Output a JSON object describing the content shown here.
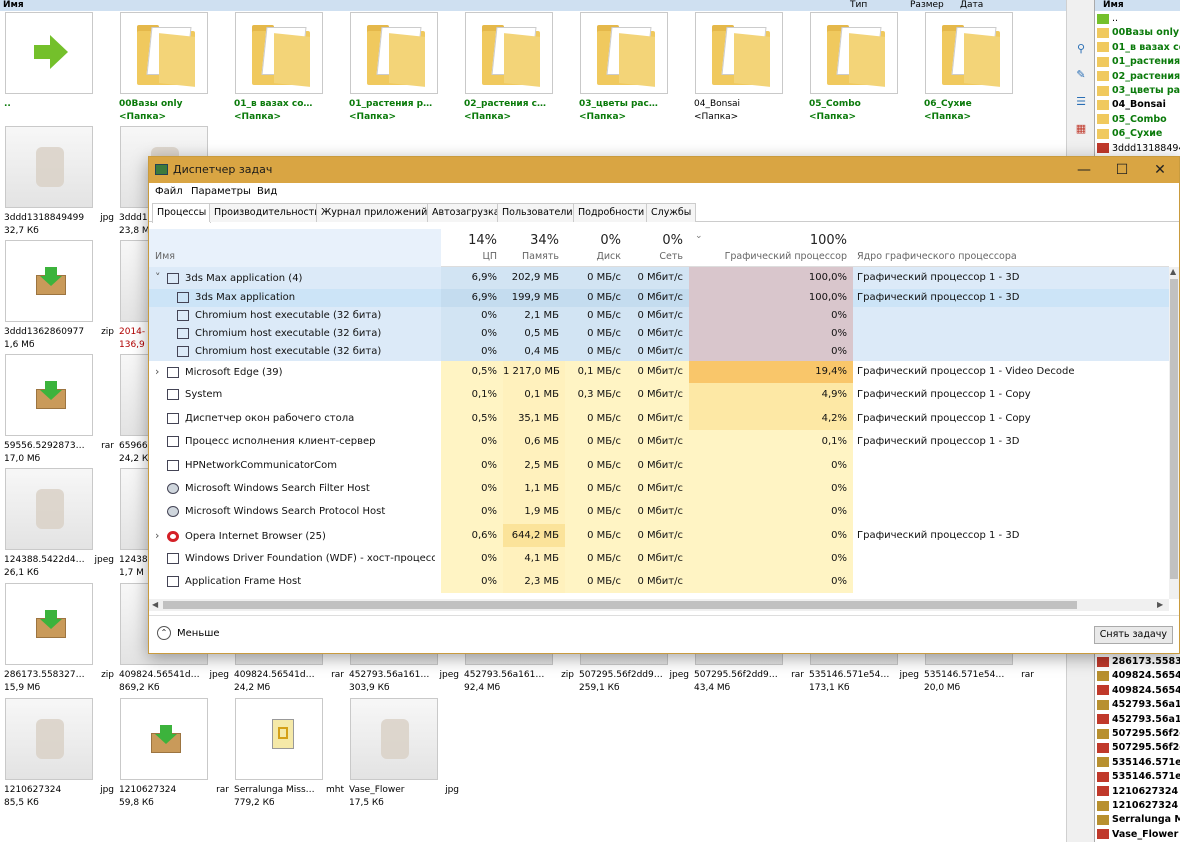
{
  "background": {
    "header": {
      "name": "Имя",
      "type": "Тип",
      "size": "Размер",
      "date": "Дата"
    },
    "tiles": [
      {
        "kind": "up",
        "name": "..",
        "sub": "",
        "ext": "",
        "green": true
      },
      {
        "kind": "folder",
        "name": "00Вазы only",
        "sub": "<Папка>",
        "ext": "",
        "green": true
      },
      {
        "kind": "folder",
        "name": "01_в вазах сорванн...",
        "sub": "<Папка>",
        "ext": "",
        "green": true
      },
      {
        "kind": "folder",
        "name": "01_растения растущ...",
        "sub": "<Папка>",
        "ext": "",
        "green": true
      },
      {
        "kind": "folder",
        "name": "02_растения свисаю...",
        "sub": "<Папка>",
        "ext": "",
        "green": true
      },
      {
        "kind": "folder",
        "name": "03_цветы растущие",
        "sub": "<Папка>",
        "ext": "",
        "green": true
      },
      {
        "kind": "folder",
        "name": "04_Bonsai",
        "sub": "<Папка>",
        "ext": "",
        "green": false
      },
      {
        "kind": "folder",
        "name": "05_Combo",
        "sub": "<Папка>",
        "ext": "",
        "green": true
      },
      {
        "kind": "folder",
        "name": "06_Сухие",
        "sub": "<Папка>",
        "ext": "",
        "green": true
      },
      {
        "kind": "img",
        "name": "3ddd1318849499",
        "sub": "32,7 Кб",
        "ext": "jpg"
      },
      {
        "kind": "img",
        "name": "3ddd1",
        "sub": "23,8 М",
        "ext": ""
      },
      {
        "kind": "box",
        "name": "3ddd1362860977",
        "sub": "1,6 Мб",
        "ext": "zip"
      },
      {
        "kind": "img",
        "name": "2014-",
        "sub": "136,9",
        "ext": "",
        "red": true
      },
      {
        "kind": "box",
        "name": "59556.529287385...",
        "sub": "17,0 Мб",
        "ext": "rar"
      },
      {
        "kind": "img",
        "name": "65966",
        "sub": "24,2 К",
        "ext": ""
      },
      {
        "kind": "img",
        "name": "124388.5422d4bf...",
        "sub": "26,1 Кб",
        "ext": "jpeg"
      },
      {
        "kind": "img",
        "name": "12438",
        "sub": "1,7 М",
        "ext": ""
      },
      {
        "kind": "box",
        "name": "286173.55832793...",
        "sub": "15,9 Мб",
        "ext": "zip"
      },
      {
        "kind": "img",
        "name": "409824.56541d6b...",
        "sub": "869,2 Кб",
        "ext": "jpeg"
      },
      {
        "kind": "img",
        "name": "409824.56541d6b...",
        "sub": "24,2 Мб",
        "ext": "rar"
      },
      {
        "kind": "img",
        "name": "452793.56a1612...",
        "sub": "303,9 Кб",
        "ext": "jpeg"
      },
      {
        "kind": "img",
        "name": "452793.56a16127...",
        "sub": "92,4 Мб",
        "ext": "zip"
      },
      {
        "kind": "img",
        "name": "507295.56f2dd90...",
        "sub": "259,1 Кб",
        "ext": "jpeg"
      },
      {
        "kind": "img",
        "name": "507295.56f2dd90f...",
        "sub": "43,4 Мб",
        "ext": "rar"
      },
      {
        "kind": "img",
        "name": "535146.571e54e...",
        "sub": "173,1 Кб",
        "ext": "jpeg"
      },
      {
        "kind": "img",
        "name": "535146.571e54e1...",
        "sub": "20,0 Мб",
        "ext": "rar"
      },
      {
        "kind": "img",
        "name": "1210627324",
        "sub": "85,5 Кб",
        "ext": "jpg"
      },
      {
        "kind": "box",
        "name": "1210627324",
        "sub": "59,8 Кб",
        "ext": "rar"
      },
      {
        "kind": "mht",
        "name": "Serralunga Misse...",
        "sub": "779,2 Кб",
        "ext": "mht"
      },
      {
        "kind": "img",
        "name": "Vase_Flower",
        "sub": "17,5 Кб",
        "ext": "jpg"
      }
    ],
    "right_panel": {
      "header": "Имя",
      "items_top": [
        "..",
        "00Вазы only",
        "01_в вазах со",
        "01_растения р",
        "02_растения с",
        "03_цветы раст",
        "04_Bonsai",
        "05_Combo",
        "06_Сухие",
        "3ddd13188494"
      ],
      "items_bottom": [
        "286173.558327",
        "409824.56541d",
        "409824.56541d",
        "452793.56a161",
        "452793.56a161",
        "507295.56f2dd",
        "507295.56f2dd",
        "535146.571e54",
        "535146.571e54",
        "1210627324",
        "1210627324",
        "Serralunga Mis",
        "Vase_Flower"
      ]
    }
  },
  "taskmgr": {
    "title": "Диспетчер задач",
    "menu": [
      "Файл",
      "Параметры",
      "Вид"
    ],
    "tabs": [
      "Процессы",
      "Производительность",
      "Журнал приложений",
      "Автозагрузка",
      "Пользователи",
      "Подробности",
      "Службы"
    ],
    "columns": {
      "name": "Имя",
      "cpu_pct": "14%",
      "cpu": "ЦП",
      "mem_pct": "34%",
      "mem": "Память",
      "disk_pct": "0%",
      "disk": "Диск",
      "net_pct": "0%",
      "net": "Сеть",
      "gpu_pct": "100%",
      "gpu": "Графический процессор",
      "engine": "Ядро графического процессора"
    },
    "rows": [
      {
        "name": "3ds Max application (4)",
        "cpu": "6,9%",
        "mem": "202,9 МБ",
        "disk": "0 МБ/с",
        "net": "0 Мбит/с",
        "gpu": "100,0%",
        "engine": "Графический процессор 1 - 3D",
        "group": true,
        "expanded": true
      },
      {
        "name": "3ds Max application",
        "cpu": "6,9%",
        "mem": "199,9 МБ",
        "disk": "0 МБ/с",
        "net": "0 Мбит/с",
        "gpu": "100,0%",
        "engine": "Графический процессор 1 - 3D",
        "child": true
      },
      {
        "name": "Chromium host executable (32 бита)",
        "cpu": "0%",
        "mem": "2,1 МБ",
        "disk": "0 МБ/с",
        "net": "0 Мбит/с",
        "gpu": "0%",
        "engine": "",
        "child": true
      },
      {
        "name": "Chromium host executable (32 бита)",
        "cpu": "0%",
        "mem": "0,5 МБ",
        "disk": "0 МБ/с",
        "net": "0 Мбит/с",
        "gpu": "0%",
        "engine": "",
        "child": true
      },
      {
        "name": "Chromium host executable (32 бита)",
        "cpu": "0%",
        "mem": "0,4 МБ",
        "disk": "0 МБ/с",
        "net": "0 Мбит/с",
        "gpu": "0%",
        "engine": "",
        "child": true
      },
      {
        "name": "Microsoft Edge (39)",
        "cpu": "0,5%",
        "mem": "1 217,0 МБ",
        "disk": "0,1 МБ/с",
        "net": "0 Мбит/с",
        "gpu": "19,4%",
        "engine": "Графический процессор 1 - Video Decode",
        "group": true
      },
      {
        "name": "System",
        "cpu": "0,1%",
        "mem": "0,1 МБ",
        "disk": "0,3 МБ/с",
        "net": "0 Мбит/с",
        "gpu": "4,9%",
        "engine": "Графический процессор 1 - Copy"
      },
      {
        "name": "Диспетчер окон рабочего стола",
        "cpu": "0,5%",
        "mem": "35,1 МБ",
        "disk": "0 МБ/с",
        "net": "0 Мбит/с",
        "gpu": "4,2%",
        "engine": "Графический процессор 1 - Copy"
      },
      {
        "name": "Процесс исполнения клиент-сервер",
        "cpu": "0%",
        "mem": "0,6 МБ",
        "disk": "0 МБ/с",
        "net": "0 Мбит/с",
        "gpu": "0,1%",
        "engine": "Графический процессор 1 - 3D"
      },
      {
        "name": "HPNetworkCommunicatorCom",
        "cpu": "0%",
        "mem": "2,5 МБ",
        "disk": "0 МБ/с",
        "net": "0 Мбит/с",
        "gpu": "0%",
        "engine": ""
      },
      {
        "name": "Microsoft Windows Search Filter Host",
        "cpu": "0%",
        "mem": "1,1 МБ",
        "disk": "0 МБ/с",
        "net": "0 Мбит/с",
        "gpu": "0%",
        "engine": ""
      },
      {
        "name": "Microsoft Windows Search Protocol Host",
        "cpu": "0%",
        "mem": "1,9 МБ",
        "disk": "0 МБ/с",
        "net": "0 Мбит/с",
        "gpu": "0%",
        "engine": ""
      },
      {
        "name": "Opera Internet Browser (25)",
        "cpu": "0,6%",
        "mem": "644,2 МБ",
        "disk": "0 МБ/с",
        "net": "0 Мбит/с",
        "gpu": "0%",
        "engine": "Графический процессор 1 - 3D",
        "group": true
      },
      {
        "name": "Windows Driver Foundation (WDF) - хост-процесс с...",
        "cpu": "0%",
        "mem": "4,1 МБ",
        "disk": "0 МБ/с",
        "net": "0 Мбит/с",
        "gpu": "0%",
        "engine": ""
      },
      {
        "name": "Application Frame Host",
        "cpu": "0%",
        "mem": "2,3 МБ",
        "disk": "0 МБ/с",
        "net": "0 Мбит/с",
        "gpu": "0%",
        "engine": ""
      }
    ],
    "footer": {
      "less": "Меньше",
      "end_task": "Снять задачу"
    }
  }
}
